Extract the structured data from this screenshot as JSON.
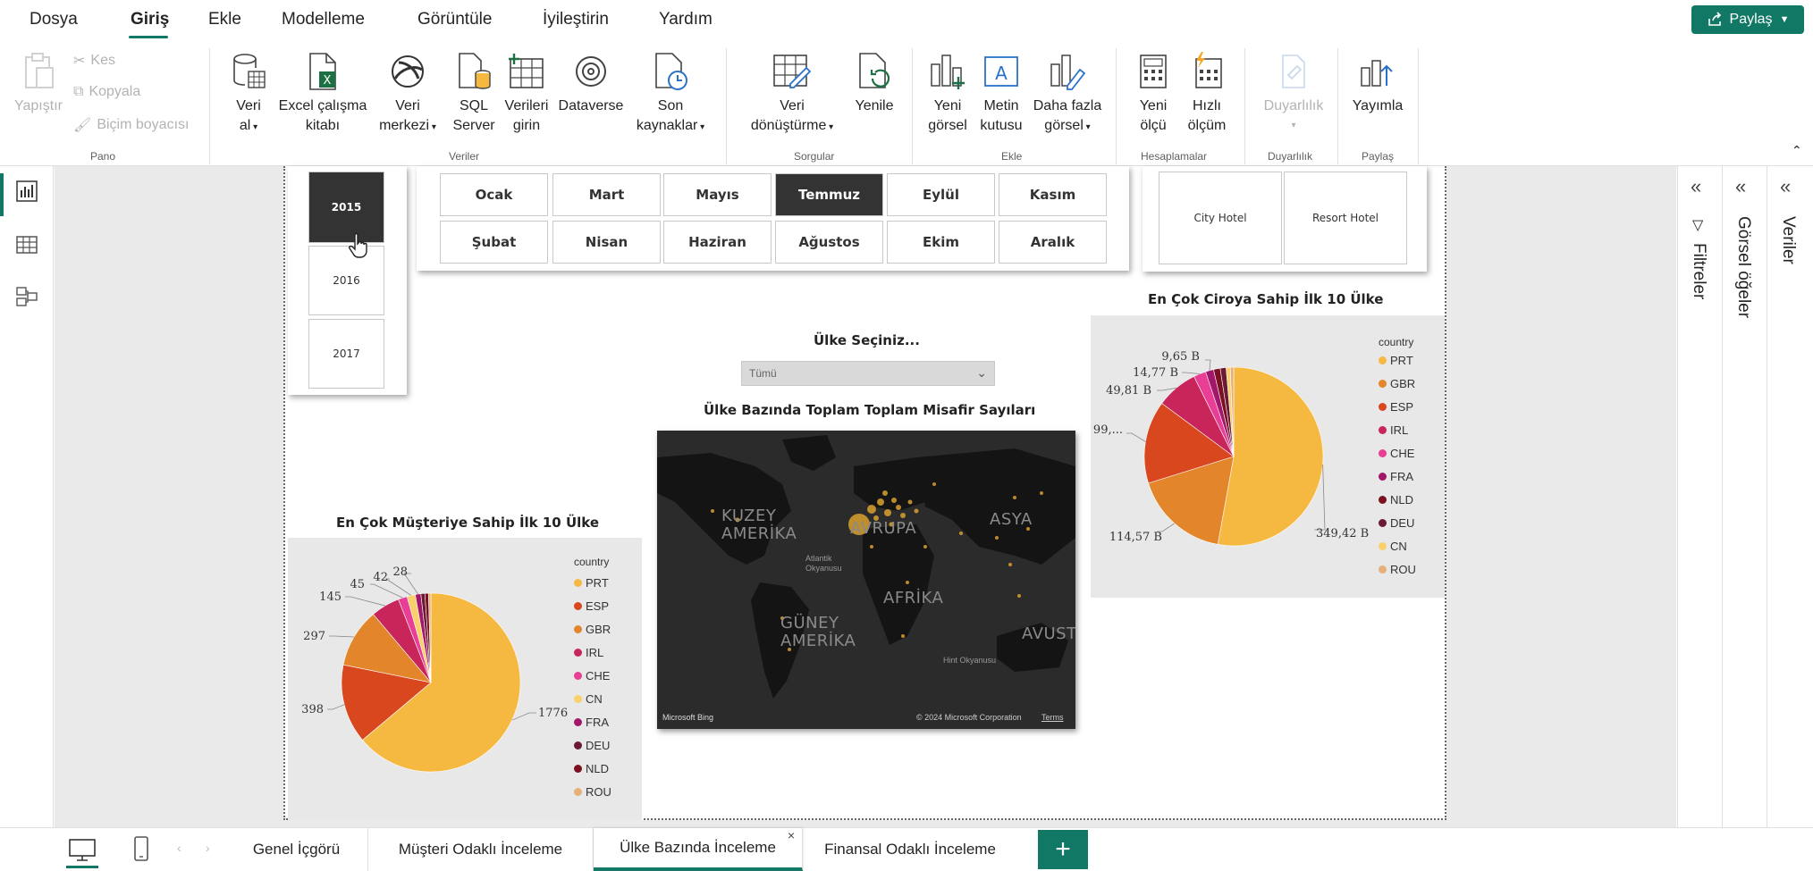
{
  "menu": {
    "items": [
      "Dosya",
      "Giriş",
      "Ekle",
      "Modelleme",
      "Görüntüle",
      "İyileştirin",
      "Yardım"
    ],
    "active": "Giriş",
    "share_label": "Paylaş"
  },
  "ribbon": {
    "pano": {
      "paste": "Yapıştır",
      "cut": "Kes",
      "copy": "Kopyala",
      "format_painter": "Biçim boyacısı",
      "label": "Pano"
    },
    "veriler": {
      "get_data": [
        "Veri",
        "al"
      ],
      "excel": [
        "Excel çalışma",
        "kitabı"
      ],
      "data_hub": [
        "Veri",
        "merkezi"
      ],
      "sql": [
        "SQL",
        "Server"
      ],
      "enter_data": [
        "Verileri",
        "girin"
      ],
      "dataverse": "Dataverse",
      "recent": [
        "Son",
        "kaynaklar"
      ],
      "label": "Veriler"
    },
    "sorgular": {
      "transform": [
        "Veri",
        "dönüştürme"
      ],
      "refresh": "Yenile",
      "label": "Sorgular"
    },
    "ekle": {
      "new_visual": [
        "Yeni",
        "görsel"
      ],
      "text_box": [
        "Metin",
        "kutusu"
      ],
      "more_visuals": [
        "Daha fazla",
        "görsel"
      ],
      "label": "Ekle"
    },
    "hesaplamalar": {
      "new_measure": [
        "Yeni",
        "ölçü"
      ],
      "quick_measure": [
        "Hızlı",
        "ölçüm"
      ],
      "label": "Hesaplamalar"
    },
    "duyarlilik": {
      "sensitivity": "Duyarlılık",
      "label": "Duyarlılık"
    },
    "paylas": {
      "publish": "Yayımla",
      "label": "Paylaş"
    }
  },
  "panes": {
    "filters": "Filtreler",
    "visuals": "Görsel öğeler",
    "data": "Veriler"
  },
  "slicers": {
    "years": [
      "2015",
      "2016",
      "2017"
    ],
    "selected_year": "2015",
    "months_row1": [
      "Ocak",
      "Mart",
      "Mayıs",
      "Temmuz",
      "Eylül",
      "Kasım"
    ],
    "months_row2": [
      "Şubat",
      "Nisan",
      "Haziran",
      "Ağustos",
      "Ekim",
      "Aralık"
    ],
    "selected_month": "Temmuz",
    "hotels": [
      "City Hotel",
      "Resort Hotel"
    ]
  },
  "country_select": {
    "label": "Ülke Seçiniz...",
    "value": "Tümü"
  },
  "map": {
    "title": "Ülke Bazında Toplam Toplam Misafir Sayıları",
    "labels": {
      "north_america": [
        "KUZEY",
        "AMERİKA"
      ],
      "europe": "AVRUPA",
      "asia": "ASYA",
      "africa": "AFRİKA",
      "south_america": [
        "GÜNEY",
        "AMERİKA"
      ],
      "australia": "AVUST",
      "atlantic": [
        "Atlantik",
        "Okyanusu"
      ],
      "indian": "Hint Okyanusu"
    },
    "attribution_left": "Microsoft Bing",
    "attribution_right": "© 2024 Microsoft Corporation",
    "terms": "Terms"
  },
  "chart_data": [
    {
      "type": "pie",
      "title": "En Çok Müşteriye Sahip İlk 10 Ülke",
      "legend_title": "country",
      "legend_position": "right",
      "categories": [
        "PRT",
        "ESP",
        "GBR",
        "IRL",
        "CHE",
        "CN",
        "FRA",
        "DEU",
        "NLD",
        "ROU"
      ],
      "values": [
        1776,
        398,
        297,
        145,
        45,
        42,
        28,
        20,
        18,
        12
      ],
      "data_labels": [
        "1776",
        "398",
        "297",
        "145",
        "45",
        "42",
        "28"
      ],
      "colors": [
        "#F5B942",
        "#D9471E",
        "#E3852A",
        "#C8265A",
        "#E83E95",
        "#F9D06B",
        "#A3176A",
        "#6B1A33",
        "#7A1020",
        "#E6B07A"
      ]
    },
    {
      "type": "pie",
      "title": "En Çok Ciroya Sahip İlk 10 Ülke",
      "legend_title": "country",
      "legend_position": "right",
      "categories": [
        "PRT",
        "GBR",
        "ESP",
        "IRL",
        "CHE",
        "FRA",
        "NLD",
        "DEU",
        "CN",
        "ROU"
      ],
      "values": [
        349.42,
        114.57,
        99,
        49.81,
        14.77,
        9.65,
        8,
        7,
        5,
        4
      ],
      "data_labels": [
        "349,42 B",
        "114,57 B",
        "99,...",
        "49,81 B",
        "14,77 B",
        "9,65 B"
      ],
      "colors": [
        "#F5B942",
        "#E3852A",
        "#D9471E",
        "#C8265A",
        "#E83E95",
        "#A3176A",
        "#7A1020",
        "#6B1A33",
        "#F9D06B",
        "#E6B07A"
      ]
    }
  ],
  "tabs": {
    "pages": [
      "Genel İçgörü",
      "Müşteri Odaklı İnceleme",
      "Ülke Bazında İnceleme",
      "Finansal Odaklı İnceleme"
    ],
    "active": "Ülke Bazında İnceleme",
    "add": "+"
  }
}
